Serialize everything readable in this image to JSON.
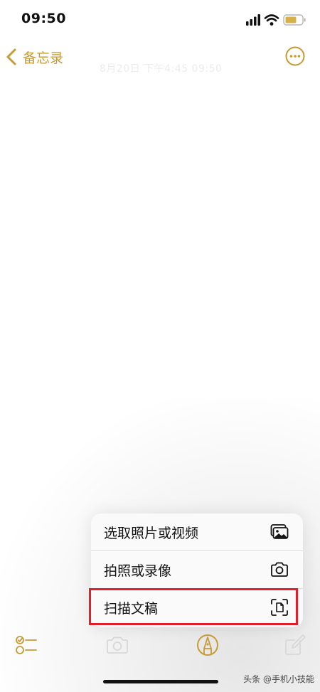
{
  "status_bar": {
    "time": "09:50"
  },
  "nav": {
    "back_label": "备忘录",
    "title": "8月20日 下午4:45 09:50"
  },
  "attachment_menu": {
    "items": [
      {
        "label": "选取照片或视频",
        "icon": "photo-library-icon"
      },
      {
        "label": "拍照或录像",
        "icon": "camera-icon"
      },
      {
        "label": "扫描文稿",
        "icon": "scan-document-icon",
        "highlighted": true
      }
    ]
  },
  "toolbar": {
    "buttons": [
      "checklist-icon",
      "camera-icon",
      "markup-icon",
      "compose-icon"
    ]
  },
  "watermark": "头条 @手机小技能",
  "colors": {
    "accent": "#c79a34",
    "highlight_border": "#e0202b",
    "battery": "#d8b04a"
  }
}
